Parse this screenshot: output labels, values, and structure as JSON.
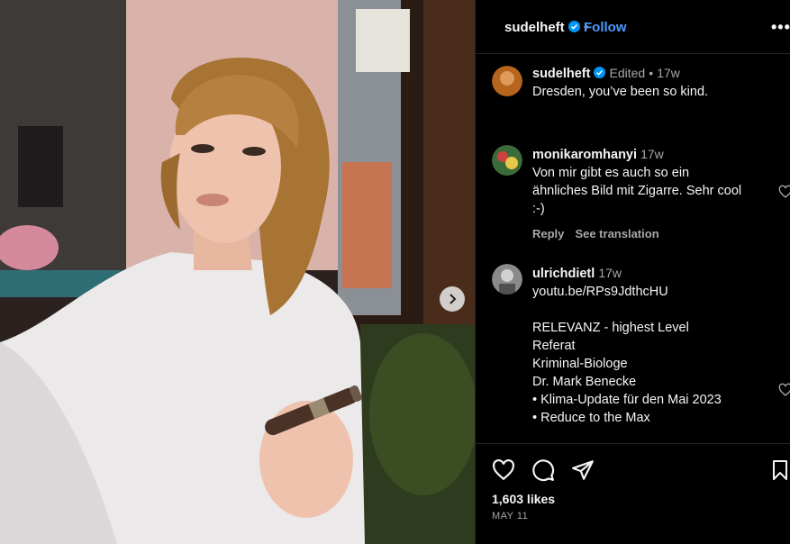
{
  "post_header": {
    "username": "sudelheft",
    "separator": "•",
    "follow_label": "Follow",
    "more_label": "•••"
  },
  "caption": {
    "username": "sudelheft",
    "edited": "Edited",
    "separator": "•",
    "age": "17w",
    "text": "Dresden, you’ve been so kind."
  },
  "comments": [
    {
      "username": "monikaromhanyi",
      "age": "17w",
      "lines": [
        "Von mir gibt es auch so ein",
        "ähnliches Bild mit Zigarre. Sehr cool",
        ":-)"
      ],
      "reply_label": "Reply",
      "translate_label": "See translation"
    },
    {
      "username": "ulrichdietl",
      "age": "17w",
      "lines": [
        "youtu.be/RPs9JdthcHU",
        "",
        "RELEVANZ - highest Level",
        "Referat",
        "Kriminal-Biologe",
        "Dr. Mark Benecke",
        "• Klima-Update für den Mai 2023",
        "• Reduce to the Max"
      ]
    }
  ],
  "footer": {
    "likes": "1,603 likes",
    "date": "MAY 11"
  },
  "colors": {
    "background": "#000000",
    "accent_blue": "#4c9bff",
    "verified_blue": "#0095f6",
    "muted_text": "#a8a8a8",
    "divider": "#262626"
  },
  "icons": [
    "verified-badge-icon",
    "more-options-icon",
    "heart-icon",
    "comment-icon",
    "share-icon",
    "bookmark-icon",
    "chevron-right-icon"
  ]
}
